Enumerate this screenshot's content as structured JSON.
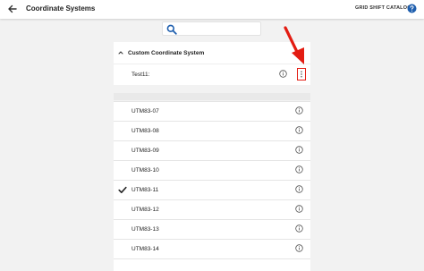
{
  "appbar": {
    "title": "Coordinate Systems",
    "grid_shift_label": "GRID SHIFT CATALOG",
    "back_icon": "arrow-left-icon",
    "help_icon": "help-circle-icon"
  },
  "search": {
    "icon": "search-icon",
    "value": "",
    "placeholder": ""
  },
  "custom_section": {
    "title": "Custom Coordinate System",
    "expand_icon": "chevron-up-icon",
    "more_icon": "more-vert-icon",
    "entries": [
      {
        "label": "Test11:",
        "info_icon": "info-icon",
        "more_icon": "more-vert-icon",
        "highlighted": true
      }
    ]
  },
  "annotation": {
    "arrow_color": "#e31c12"
  },
  "list": {
    "items": [
      {
        "label": "UTM83-07",
        "selected": false
      },
      {
        "label": "UTM83-08",
        "selected": false
      },
      {
        "label": "UTM83-09",
        "selected": false
      },
      {
        "label": "UTM83-10",
        "selected": false
      },
      {
        "label": "UTM83-11",
        "selected": true
      },
      {
        "label": "UTM83-12",
        "selected": false
      },
      {
        "label": "UTM83-13",
        "selected": false
      },
      {
        "label": "UTM83-14",
        "selected": false
      }
    ]
  },
  "colors": {
    "background": "#f2f2f2",
    "surface": "#ffffff",
    "accent_blue": "#1f5fae",
    "highlight_red": "#e31c12"
  }
}
